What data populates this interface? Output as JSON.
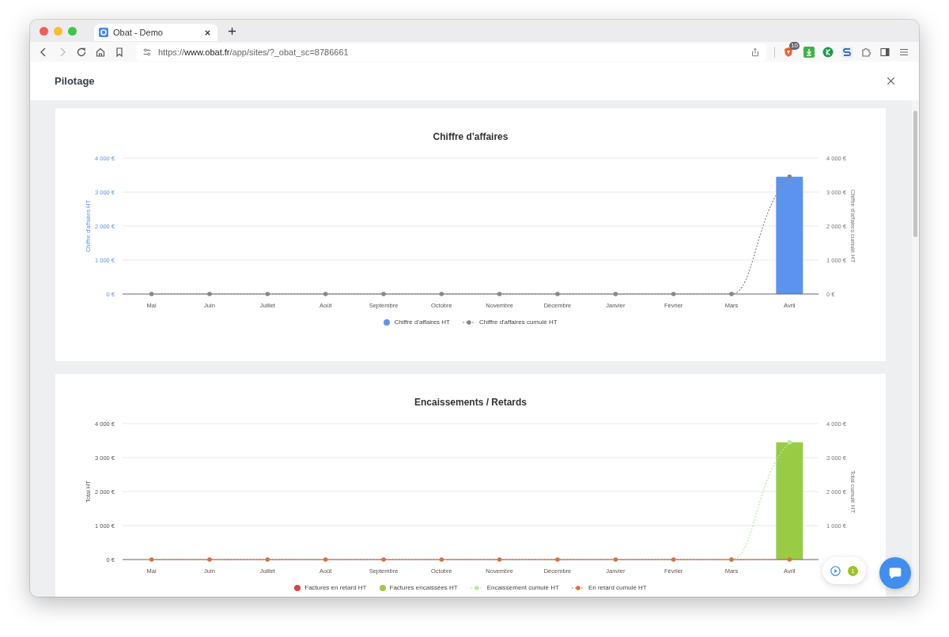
{
  "browser": {
    "tab_title": "Obat - Demo",
    "url": {
      "scheme": "https://",
      "host": "www.obat.fr",
      "path": "/app/sites/?_obat_sc=8786661"
    },
    "shield_badge": "10"
  },
  "modal": {
    "title": "Pilotage"
  },
  "charts": [
    {
      "title": "Chiffre d'affaires",
      "left_axis_colored": true,
      "chart_data": {
        "type": "bar",
        "grid": true,
        "y2lim": [
          0,
          4000
        ],
        "categories": [
          "Mai",
          "Juin",
          "Juillet",
          "Août",
          "Septembre",
          "Octobre",
          "Novembre",
          "Décembre",
          "Janvier",
          "Février",
          "Mars",
          "Avril"
        ],
        "ylabel": "Chiffre d'affaires HT",
        "y2label": "Chiffre d'affaires cumulé HT",
        "ylim": [
          0,
          4000
        ],
        "yticks": [
          {
            "value": 0,
            "label": "0 €"
          },
          {
            "value": 1000,
            "label": "1 000 €"
          },
          {
            "value": 2000,
            "label": "2 000 €"
          },
          {
            "value": 3000,
            "label": "3 000 €"
          },
          {
            "value": 4000,
            "label": "4 000 €"
          }
        ],
        "y2ticks": [
          {
            "value": 0,
            "label": "0 €"
          },
          {
            "value": 1000,
            "label": "1 000 €"
          },
          {
            "value": 2000,
            "label": "2 000 €"
          },
          {
            "value": 3000,
            "label": "3 000 €"
          },
          {
            "value": 4000,
            "label": "4 000 €"
          }
        ],
        "series": [
          {
            "name": "Chiffre d'affaires HT",
            "type": "bar",
            "color": "#5b93ee",
            "values": [
              0,
              0,
              0,
              0,
              0,
              0,
              0,
              0,
              0,
              0,
              0,
              3450
            ]
          },
          {
            "name": "Chiffre d'affaires cumulé HT",
            "type": "line",
            "line_style": "dotted",
            "color": "#888888",
            "values": [
              0,
              0,
              0,
              0,
              0,
              0,
              0,
              0,
              0,
              0,
              0,
              3450
            ]
          }
        ]
      }
    },
    {
      "title": "Encaissements / Retards",
      "chart_data": {
        "type": "bar",
        "grid": true,
        "y2lim": [
          0,
          4000
        ],
        "categories": [
          "Mai",
          "Juin",
          "Juillet",
          "Août",
          "Septembre",
          "Octobre",
          "Novembre",
          "Décembre",
          "Janvier",
          "Février",
          "Mars",
          "Avril"
        ],
        "ylabel": "Total HT",
        "y2label": "Total cumulé HT",
        "ylim": [
          0,
          4000
        ],
        "yticks": [
          {
            "value": 0,
            "label": "0 €"
          },
          {
            "value": 1000,
            "label": "1 000 €"
          },
          {
            "value": 2000,
            "label": "2 000 €"
          },
          {
            "value": 3000,
            "label": "3 000 €"
          },
          {
            "value": 4000,
            "label": "4 000 €"
          }
        ],
        "y2ticks": [
          {
            "value": 1000,
            "label": "1 000 €"
          },
          {
            "value": 2000,
            "label": "2 000 €"
          },
          {
            "value": 3000,
            "label": "3 000 €"
          },
          {
            "value": 4000,
            "label": "4 000 €"
          }
        ],
        "series": [
          {
            "name": "Factures en retard HT",
            "type": "bar",
            "color": "#d9434b",
            "values": [
              0,
              0,
              0,
              0,
              0,
              0,
              0,
              0,
              0,
              0,
              0,
              0
            ]
          },
          {
            "name": "Factures encaissées HT",
            "type": "bar",
            "color": "#99cc44",
            "values": [
              0,
              0,
              0,
              0,
              0,
              0,
              0,
              0,
              0,
              0,
              0,
              3450
            ]
          },
          {
            "name": "Encaissement cumulé HT",
            "type": "line",
            "line_style": "dotted",
            "color": "#b5eaa0",
            "values": [
              null,
              null,
              null,
              null,
              null,
              null,
              null,
              null,
              null,
              null,
              0,
              3450
            ]
          },
          {
            "name": "En retard cumulé HT",
            "type": "line",
            "line_style": "dotted",
            "color": "#d9703f",
            "values": [
              0,
              0,
              0,
              0,
              0,
              0,
              0,
              0,
              0,
              0,
              0,
              0
            ]
          }
        ]
      }
    }
  ],
  "widget": {
    "notification_count": "1"
  }
}
